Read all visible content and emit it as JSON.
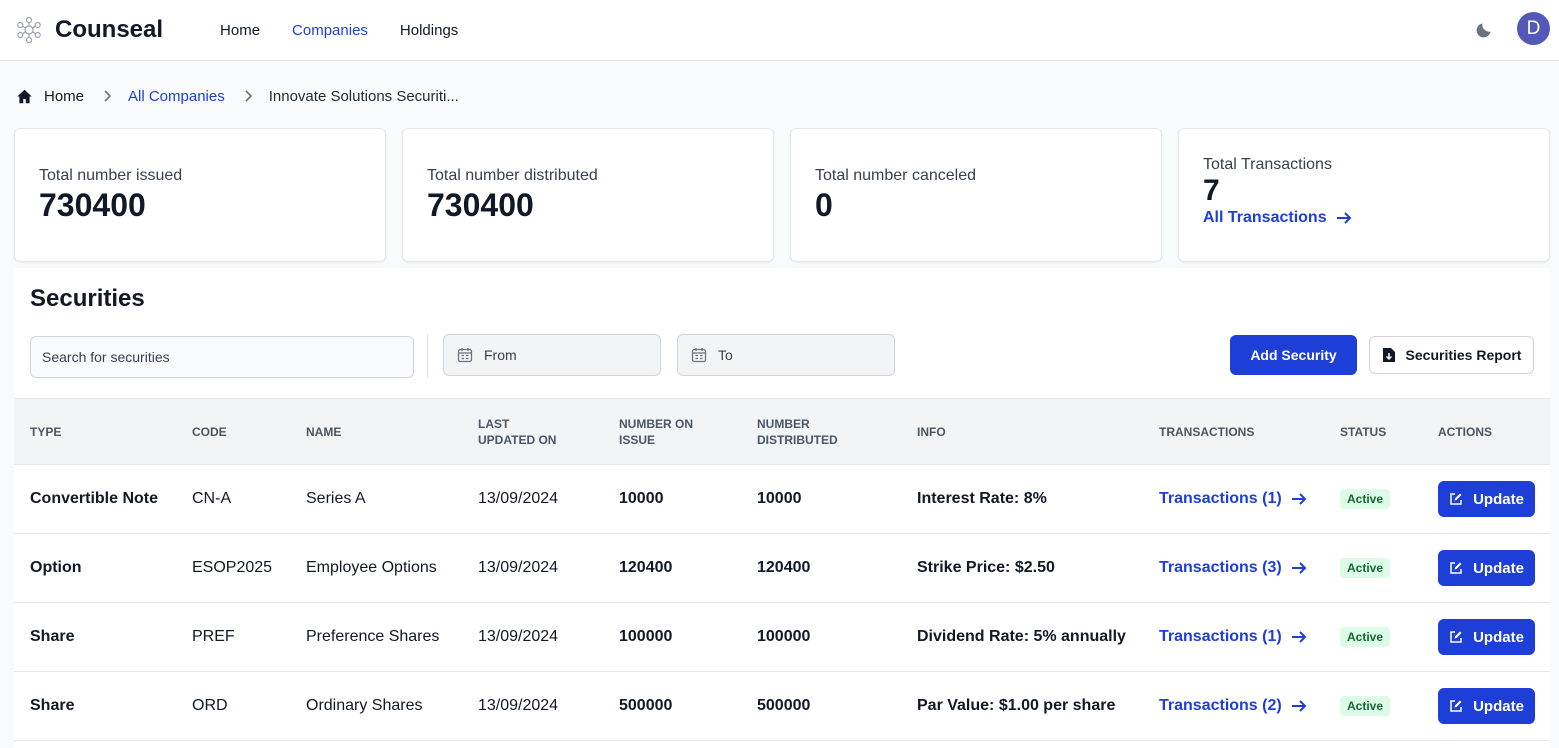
{
  "app": {
    "name": "Counseal"
  },
  "nav": {
    "items": [
      "Home",
      "Companies",
      "Holdings"
    ],
    "active": "Companies"
  },
  "user": {
    "avatar_initial": "D"
  },
  "breadcrumb": {
    "home": "Home",
    "companies": "All Companies",
    "current": "Innovate Solutions Securiti..."
  },
  "stats": {
    "issued": {
      "label": "Total number issued",
      "value": "730400"
    },
    "distributed": {
      "label": "Total number distributed",
      "value": "730400"
    },
    "canceled": {
      "label": "Total number canceled",
      "value": "0"
    },
    "transactions": {
      "label": "Total Transactions",
      "value": "7",
      "link": "All Transactions"
    }
  },
  "securities": {
    "title": "Securities",
    "search_placeholder": "Search for securities",
    "from_label": "From",
    "to_label": "To",
    "add_button": "Add Security",
    "report_button": "Securities Report",
    "columns": [
      "TYPE",
      "CODE",
      "NAME",
      "LAST UPDATED ON",
      "NUMBER ON ISSUE",
      "NUMBER DISTRIBUTED",
      "INFO",
      "TRANSACTIONS",
      "STATUS",
      "ACTIONS"
    ],
    "rows": [
      {
        "type": "Convertible Note",
        "code": "CN-A",
        "name": "Series A",
        "updated": "13/09/2024",
        "on_issue": "10000",
        "distributed": "10000",
        "info": "Interest Rate: 8%",
        "transactions": "Transactions (1)",
        "status": "Active",
        "action": "Update"
      },
      {
        "type": "Option",
        "code": "ESOP2025",
        "name": "Employee Options",
        "updated": "13/09/2024",
        "on_issue": "120400",
        "distributed": "120400",
        "info": "Strike Price: $2.50",
        "transactions": "Transactions (3)",
        "status": "Active",
        "action": "Update"
      },
      {
        "type": "Share",
        "code": "PREF",
        "name": "Preference Shares",
        "updated": "13/09/2024",
        "on_issue": "100000",
        "distributed": "100000",
        "info": "Dividend Rate: 5% annually",
        "transactions": "Transactions (1)",
        "status": "Active",
        "action": "Update"
      },
      {
        "type": "Share",
        "code": "ORD",
        "name": "Ordinary Shares",
        "updated": "13/09/2024",
        "on_issue": "500000",
        "distributed": "500000",
        "info": "Par Value: $1.00 per share",
        "transactions": "Transactions (2)",
        "status": "Active",
        "action": "Update"
      }
    ]
  },
  "colors": {
    "accent": "#1d3fd8",
    "avatar": "#5458b8",
    "badge_bg": "#dcfce7",
    "badge_text": "#166534"
  }
}
